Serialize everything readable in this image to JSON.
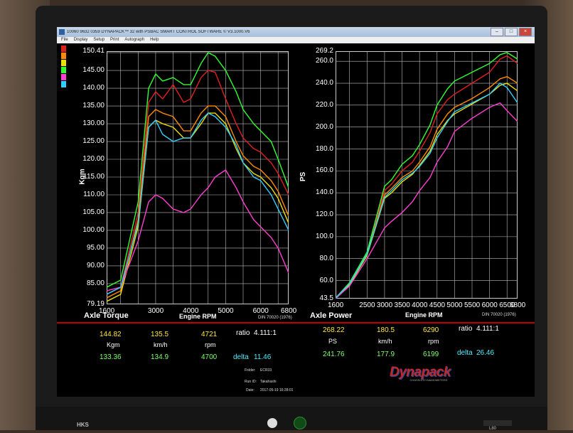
{
  "window": {
    "title": "10060 9632 0359 DYNAPACK™ 32 with PSBAC SMART CONTROL SOFTWARE © V3.1000.V6"
  },
  "menu": [
    "File",
    "Display",
    "Setup",
    "Print",
    "Autograph",
    "Help"
  ],
  "window_buttons": [
    "–",
    "□",
    "×"
  ],
  "legend_colors": [
    "#e02020",
    "#ff8a00",
    "#f0e000",
    "#30ff30",
    "#ff3fd0",
    "#30d0ff"
  ],
  "torque_chart": {
    "title": "Axle Torque",
    "xlabel": "Engine RPM",
    "ylabel": "Kgm",
    "norm": "DIN 70020 (1976)",
    "y_ticks": [
      "150.41",
      "145.00",
      "140.00",
      "135.00",
      "130.00",
      "125.00",
      "120.00",
      "115.00",
      "110.00",
      "105.00",
      "100.00",
      "95.00",
      "90.00",
      "85.00",
      "79.19"
    ],
    "x_ticks": [
      "1600",
      "3000",
      "4000",
      "5000",
      "6000",
      "6800"
    ],
    "x_first_label": "1600"
  },
  "power_chart": {
    "title": "Axle Power",
    "xlabel": "Engine RPM",
    "ylabel": "PS",
    "norm": "DIN 70020 (1976)",
    "y_ticks": [
      "269.2",
      "260.0",
      "240.0",
      "220.0",
      "200.0",
      "180.0",
      "160.0",
      "140.0",
      "120.0",
      "100.0",
      "80.0",
      "60.0",
      "43.5"
    ],
    "x_ticks": [
      "1600",
      "2500",
      "3000",
      "3500",
      "4000",
      "4500",
      "5000",
      "5500",
      "6000",
      "6500",
      "6800"
    ]
  },
  "chart_data": [
    {
      "type": "line",
      "title": "Axle Torque",
      "xlabel": "Engine RPM",
      "ylabel": "Kgm",
      "xlim": [
        1600,
        6800
      ],
      "ylim": [
        79.19,
        150.41
      ],
      "x": [
        1600,
        2000,
        2500,
        2800,
        3000,
        3200,
        3500,
        3800,
        4000,
        4300,
        4500,
        4700,
        5000,
        5300,
        5500,
        5800,
        6000,
        6300,
        6500,
        6800
      ],
      "series": [
        {
          "color": "#e02020",
          "values": [
            82,
            84,
            105,
            136,
            139,
            137,
            141,
            136,
            137,
            143,
            145,
            144.5,
            137,
            130,
            126,
            123,
            122,
            119,
            116,
            110
          ]
        },
        {
          "color": "#ff8a00",
          "values": [
            81,
            83,
            103,
            132,
            134,
            133,
            132,
            128,
            128,
            133,
            135,
            135,
            132,
            125,
            121,
            118,
            117,
            114,
            111,
            104
          ]
        },
        {
          "color": "#f0e000",
          "values": [
            80,
            82,
            101,
            129,
            131,
            130,
            129,
            126,
            126,
            130,
            133,
            133,
            130,
            123,
            119,
            116,
            115,
            112,
            109,
            102
          ]
        },
        {
          "color": "#30ff30",
          "values": [
            84,
            86,
            108,
            140,
            144,
            142,
            143,
            141,
            141,
            147,
            150,
            149,
            145,
            139,
            134,
            130,
            128,
            125,
            120,
            112
          ]
        },
        {
          "color": "#ff3fd0",
          "values": [
            83,
            84,
            97,
            108,
            110,
            109,
            106,
            105,
            106,
            110,
            112,
            115,
            117,
            112,
            108,
            103,
            101,
            98,
            95,
            88
          ]
        },
        {
          "color": "#30d0ff",
          "values": [
            82,
            84,
            102,
            129,
            131,
            127,
            125,
            126,
            126,
            131,
            133,
            132,
            129,
            124,
            119,
            115,
            114,
            110,
            106,
            100
          ]
        }
      ]
    },
    {
      "type": "line",
      "title": "Axle Power",
      "xlabel": "Engine RPM",
      "ylabel": "PS",
      "xlim": [
        1600,
        6800
      ],
      "ylim": [
        43.5,
        269.2
      ],
      "x": [
        1600,
        2000,
        2500,
        3000,
        3200,
        3500,
        3800,
        4000,
        4300,
        4500,
        4800,
        5000,
        5500,
        6000,
        6300,
        6500,
        6800
      ],
      "series": [
        {
          "color": "#e02020",
          "values": [
            44,
            58,
            85,
            142,
            148,
            160,
            168,
            178,
            195,
            212,
            225,
            230,
            240,
            250,
            262,
            265,
            258
          ]
        },
        {
          "color": "#ff8a00",
          "values": [
            44,
            57,
            84,
            138,
            144,
            154,
            160,
            168,
            182,
            198,
            212,
            218,
            226,
            236,
            244,
            246,
            240
          ]
        },
        {
          "color": "#f0e000",
          "values": [
            44,
            56,
            83,
            135,
            140,
            150,
            157,
            165,
            178,
            193,
            206,
            212,
            221,
            230,
            238,
            240,
            233
          ]
        },
        {
          "color": "#30ff30",
          "values": [
            44,
            58,
            86,
            146,
            152,
            166,
            174,
            184,
            202,
            220,
            235,
            242,
            250,
            258,
            266,
            268,
            262
          ]
        },
        {
          "color": "#ff3fd0",
          "values": [
            43.5,
            55,
            80,
            108,
            114,
            122,
            132,
            142,
            154,
            168,
            182,
            196,
            208,
            218,
            222,
            215,
            205
          ]
        },
        {
          "color": "#30d0ff",
          "values": [
            44,
            57,
            84,
            136,
            142,
            152,
            158,
            164,
            176,
            190,
            205,
            214,
            222,
            230,
            240,
            236,
            222
          ]
        }
      ]
    }
  ],
  "readout_left": {
    "row1": {
      "kgm": "144.82",
      "kmh": "135.5",
      "rpm": "4721",
      "ratio_label": "ratio",
      "ratio": "4.111:1"
    },
    "units": {
      "kgm": "Kgm",
      "kmh": "km/h",
      "rpm": "rpm"
    },
    "row2": {
      "kgm": "133.36",
      "kmh": "134.9",
      "rpm": "4700",
      "delta_label": "delta",
      "delta": "11.46"
    }
  },
  "readout_right": {
    "row1": {
      "ps": "268.22",
      "kmh": "180.5",
      "rpm": "6290",
      "ratio_label": "ratio",
      "ratio": "4.111:1"
    },
    "units": {
      "ps": "PS",
      "kmh": "km/h",
      "rpm": "rpm"
    },
    "row2": {
      "ps": "241.76",
      "kmh": "177.9",
      "rpm": "6199",
      "delta_label": "delta",
      "delta": "26.46"
    }
  },
  "info": {
    "folder_label": "Folder:",
    "folder": "ECR33",
    "run_label": "Run ID:",
    "run": "Takahashi",
    "date_label": "Date:",
    "date": "2017-05-19 16:28:01"
  },
  "logo": {
    "text": "Dynapack",
    "sub": "CHASSIS DYNAMOMETERS"
  },
  "monitor": {
    "brand": "HKS",
    "model": "L80"
  }
}
